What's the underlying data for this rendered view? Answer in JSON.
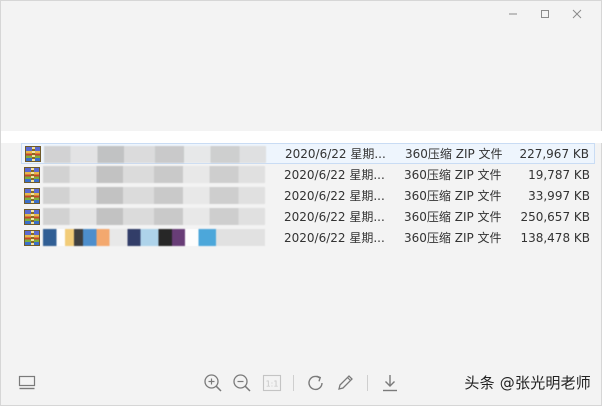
{
  "window": {
    "controls": [
      "minimize",
      "maximize",
      "close"
    ]
  },
  "files": [
    {
      "date": "2020/6/22 星期...",
      "type": "360压缩 ZIP 文件",
      "size": "227,967 KB",
      "selected": true
    },
    {
      "date": "2020/6/22 星期...",
      "type": "360压缩 ZIP 文件",
      "size": "19,787 KB",
      "selected": false
    },
    {
      "date": "2020/6/22 星期...",
      "type": "360压缩 ZIP 文件",
      "size": "33,997 KB",
      "selected": false
    },
    {
      "date": "2020/6/22 星期...",
      "type": "360压缩 ZIP 文件",
      "size": "250,657 KB",
      "selected": false
    },
    {
      "date": "2020/6/22 星期...",
      "type": "360压缩 ZIP 文件",
      "size": "138,478 KB",
      "selected": false
    }
  ],
  "toolbar": {
    "icons": [
      "thumbnail-strip-icon",
      "zoom-in-icon",
      "zoom-out-icon",
      "actual-size-icon",
      "rotate-icon",
      "edit-icon",
      "download-icon"
    ],
    "actual_size_label": "1:1"
  },
  "watermark": "头条 @张光明老师",
  "colors": {
    "background": "#f3f3f3",
    "selected_row": "#eef5fd",
    "icon_gray": "#7a7a7a"
  }
}
